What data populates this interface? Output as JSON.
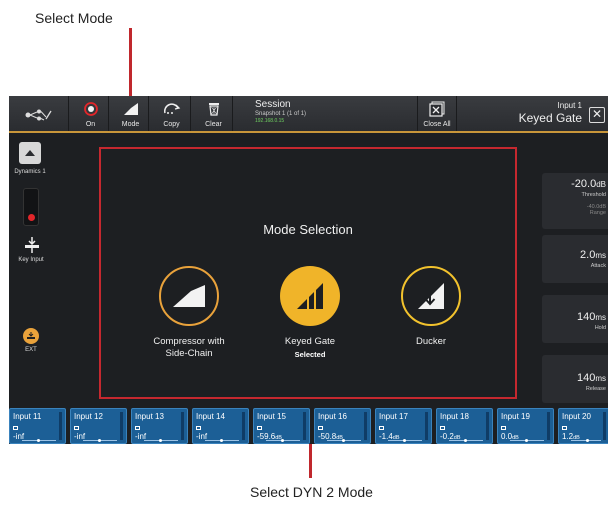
{
  "annotations": {
    "top": "Select Mode",
    "bottom": "Select DYN 2 Mode"
  },
  "toolbar": {
    "on_label": "On",
    "mode_label": "Mode",
    "copy_label": "Copy",
    "clear_label": "Clear",
    "close_all_label": "Close All"
  },
  "session": {
    "title": "Session",
    "snapshot": "Snapshot 1 (1 of 1)",
    "ip": "192.168.0.15"
  },
  "header": {
    "channel": "Input 1",
    "mode": "Keyed Gate",
    "close_icon": "close-icon"
  },
  "left": {
    "dynamics_label": "Dynamics 1",
    "key_input_label": "Key Input",
    "ext_label": "EXT"
  },
  "mode_selection": {
    "title": "Mode Selection",
    "modes": [
      {
        "label_line1": "Compressor with",
        "label_line2": "Side-Chain",
        "selected_text": "",
        "color": "#e9a23b"
      },
      {
        "label_line1": "Keyed Gate",
        "label_line2": "",
        "selected_text": "Selected",
        "color": "#f0b429"
      },
      {
        "label_line1": "Ducker",
        "label_line2": "",
        "selected_text": "",
        "color": "#f2c22d"
      }
    ]
  },
  "params": {
    "threshold": {
      "value": "-20.0",
      "unit": "dB",
      "name": "Threshold"
    },
    "range": {
      "value": "-40.0dB",
      "name": "Range"
    },
    "attack": {
      "value": "2.0",
      "unit": "ms",
      "name": "Attack"
    },
    "hold": {
      "value": "140",
      "unit": "ms",
      "name": "Hold"
    },
    "release": {
      "value": "140",
      "unit": "ms",
      "name": "Release"
    }
  },
  "strips": [
    {
      "name": "Input 11",
      "value": "-inf",
      "unit": ""
    },
    {
      "name": "Input 12",
      "value": "-inf",
      "unit": ""
    },
    {
      "name": "Input 13",
      "value": "-inf",
      "unit": ""
    },
    {
      "name": "Input 14",
      "value": "-inf",
      "unit": ""
    },
    {
      "name": "Input 15",
      "value": "-59.6",
      "unit": "dB"
    },
    {
      "name": "Input 16",
      "value": "-50.8",
      "unit": "dB"
    },
    {
      "name": "Input 17",
      "value": "-1.4",
      "unit": "dB"
    },
    {
      "name": "Input 18",
      "value": "-0.2",
      "unit": "dB"
    },
    {
      "name": "Input 19",
      "value": "0.0",
      "unit": "dB"
    },
    {
      "name": "Input 20",
      "value": "1.2",
      "unit": "dB"
    }
  ],
  "colors": {
    "accent": "#e9a23b",
    "highlight_border": "#c5282f",
    "strip_blue": "#1c5f96"
  }
}
